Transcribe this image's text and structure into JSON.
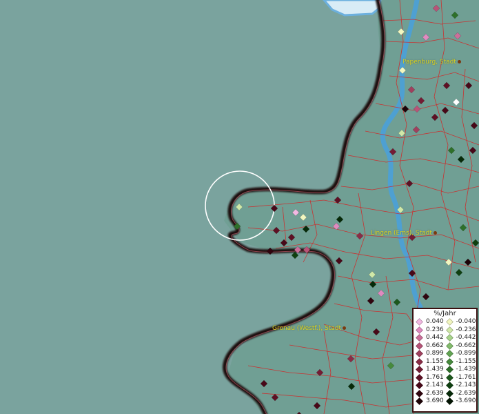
{
  "map": {
    "colors": {
      "land": "#7aa39e",
      "water_river": "#4aa0d8",
      "border": "#1a0a0a",
      "admin_lines": "#d82020"
    },
    "cities": [
      {
        "name": "Papenburg, Stadt",
        "icon": "city-marker"
      },
      {
        "name": "Lingen (Ems), Stadt",
        "icon": "city-marker"
      },
      {
        "name": "Gronau (Westf.), Stadt",
        "icon": "city-marker"
      }
    ],
    "highlight": {
      "icon": "selection-circle"
    }
  },
  "legend": {
    "title": "%/Jahr",
    "positive": [
      {
        "label": "0.040",
        "color": "#f2b8e2"
      },
      {
        "label": "0.236",
        "color": "#e08ac0"
      },
      {
        "label": "0.442",
        "color": "#cc6f9a"
      },
      {
        "label": "0.662",
        "color": "#b85478"
      },
      {
        "label": "0.899",
        "color": "#a0405e"
      },
      {
        "label": "1.155",
        "color": "#8a2c46"
      },
      {
        "label": "1.439",
        "color": "#741c34"
      },
      {
        "label": "1.761",
        "color": "#5e1024"
      },
      {
        "label": "2.143",
        "color": "#480818"
      },
      {
        "label": "2.639",
        "color": "#30040e"
      },
      {
        "label": "3.690",
        "color": "#1c0206"
      }
    ],
    "negative": [
      {
        "label": "-0.040",
        "color": "#f2f6c0"
      },
      {
        "label": "-0.236",
        "color": "#d0e8a8"
      },
      {
        "label": "-0.442",
        "color": "#a8d48a"
      },
      {
        "label": "-0.662",
        "color": "#82bc6c"
      },
      {
        "label": "-0.899",
        "color": "#62a452"
      },
      {
        "label": "-1.155",
        "color": "#468a3c"
      },
      {
        "label": "-1.439",
        "color": "#2e702a"
      },
      {
        "label": "-1.761",
        "color": "#1c581c"
      },
      {
        "label": "-2.143",
        "color": "#0e4010"
      },
      {
        "label": "-2.639",
        "color": "#062a08"
      },
      {
        "label": "-3.690",
        "color": "#021402"
      }
    ]
  }
}
